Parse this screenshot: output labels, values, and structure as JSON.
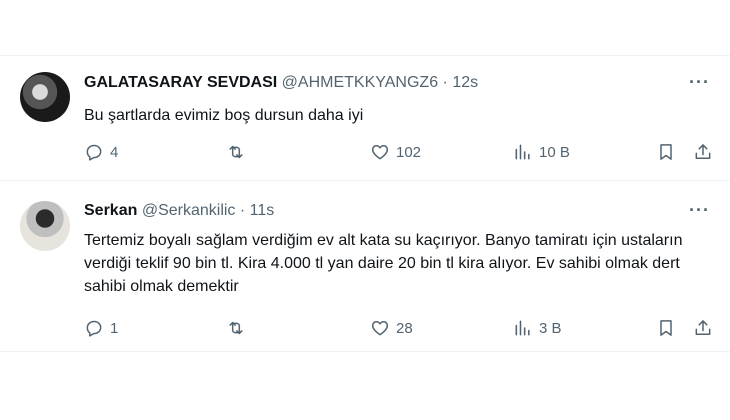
{
  "tweets": [
    {
      "name": "GALATASARAY SEVDASI",
      "handle": "@AHMETKKYANGZ6",
      "separator": "·",
      "time": "12s",
      "text": "Bu şartlarda evimiz boş dursun daha iyi",
      "more": "···",
      "replies": "4",
      "retweets": "",
      "likes": "102",
      "views": "10 B"
    },
    {
      "name": "Serkan",
      "handle": "@Serkankilic",
      "separator": "·",
      "time": "11s",
      "text": "Tertemiz boyalı sağlam verdiğim ev alt kata su kaçırıyor. Banyo tamiratı için ustaların verdiği teklif 90 bin tl. Kira 4.000 tl yan daire 20 bin tl kira alıyor. Ev sahibi olmak dert sahibi olmak demektir",
      "more": "···",
      "replies": "1",
      "retweets": "",
      "likes": "28",
      "views": "3 B"
    }
  ],
  "icons": {
    "reply": "reply-icon",
    "retweet": "retweet-icon",
    "like": "heart-icon",
    "views": "views-bar-chart-icon",
    "bookmark": "bookmark-icon",
    "share": "share-icon",
    "more": "more-dots-icon"
  },
  "colors": {
    "text": "#0f1419",
    "secondary": "#536471",
    "divider": "#eff3f4",
    "background": "#ffffff"
  }
}
